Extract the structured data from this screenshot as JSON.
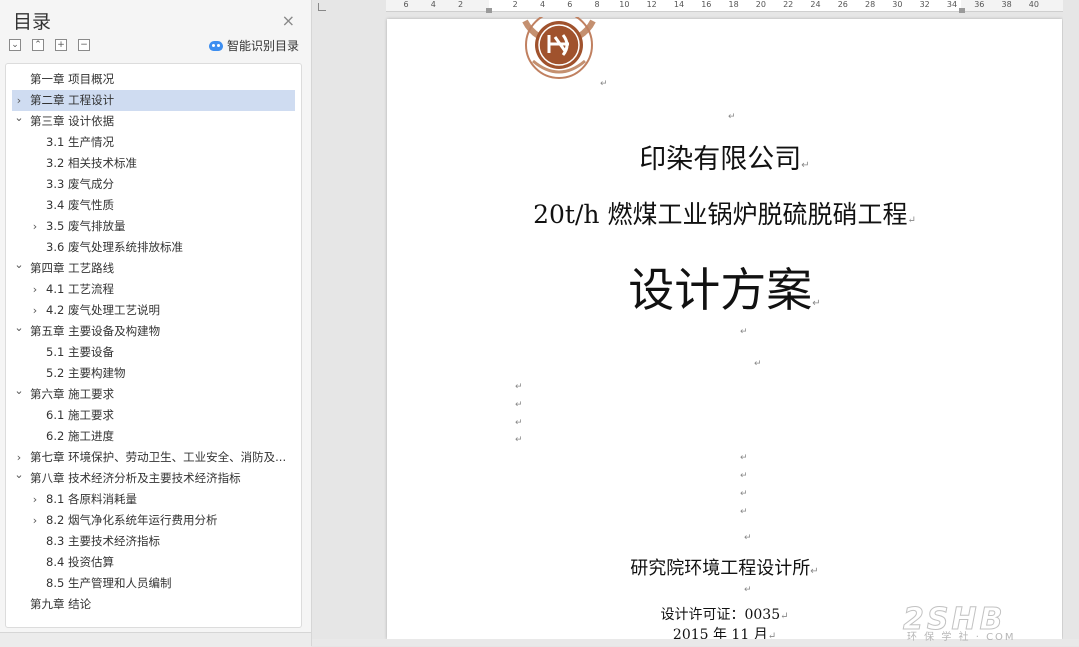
{
  "toc": {
    "title": "目录",
    "close_glyph": "×",
    "smart_label": "智能识别目录",
    "tool_icons": [
      "collapse-all-icon",
      "expand-all-icon",
      "add-heading-icon",
      "remove-heading-icon"
    ],
    "items": [
      {
        "label": "第一章 项目概况",
        "level": 1,
        "chevron": ""
      },
      {
        "label": "第二章 工程设计",
        "level": 1,
        "chevron": "right",
        "selected": true
      },
      {
        "label": "第三章 设计依据",
        "level": 1,
        "chevron": "down"
      },
      {
        "label": "3.1 生产情况",
        "level": 2,
        "chevron": ""
      },
      {
        "label": "3.2 相关技术标准",
        "level": 2,
        "chevron": ""
      },
      {
        "label": "3.3 废气成分",
        "level": 2,
        "chevron": ""
      },
      {
        "label": "3.4 废气性质",
        "level": 2,
        "chevron": ""
      },
      {
        "label": "3.5 废气排放量",
        "level": 2,
        "chevron": "right"
      },
      {
        "label": "3.6 废气处理系统排放标准",
        "level": 2,
        "chevron": ""
      },
      {
        "label": "第四章 工艺路线",
        "level": 1,
        "chevron": "down"
      },
      {
        "label": "4.1 工艺流程",
        "level": 2,
        "chevron": "right"
      },
      {
        "label": "4.2 废气处理工艺说明",
        "level": 2,
        "chevron": "right"
      },
      {
        "label": "第五章 主要设备及构建物",
        "level": 1,
        "chevron": "down"
      },
      {
        "label": "5.1 主要设备",
        "level": 2,
        "chevron": ""
      },
      {
        "label": "5.2 主要构建物",
        "level": 2,
        "chevron": ""
      },
      {
        "label": "第六章 施工要求",
        "level": 1,
        "chevron": "down"
      },
      {
        "label": "6.1 施工要求",
        "level": 2,
        "chevron": ""
      },
      {
        "label": "6.2 施工进度",
        "level": 2,
        "chevron": ""
      },
      {
        "label": "第七章 环境保护、劳动卫生、工业安全、消防及...",
        "level": 1,
        "chevron": "right"
      },
      {
        "label": "第八章 技术经济分析及主要技术经济指标",
        "level": 1,
        "chevron": "down"
      },
      {
        "label": "8.1 各原料消耗量",
        "level": 2,
        "chevron": "right"
      },
      {
        "label": "8.2 烟气净化系统年运行费用分析",
        "level": 2,
        "chevron": "right"
      },
      {
        "label": "8.3 主要技术经济指标",
        "level": 2,
        "chevron": ""
      },
      {
        "label": "8.4 投资估算",
        "level": 2,
        "chevron": ""
      },
      {
        "label": "8.5 生产管理和人员编制",
        "level": 2,
        "chevron": ""
      },
      {
        "label": "第九章 结论",
        "level": 1,
        "chevron": ""
      }
    ]
  },
  "ruler": {
    "ticks": [
      "6",
      "4",
      "2",
      "",
      "2",
      "4",
      "6",
      "8",
      "10",
      "12",
      "14",
      "16",
      "18",
      "20",
      "22",
      "24",
      "26",
      "28",
      "30",
      "32",
      "34",
      "36",
      "38",
      "40"
    ]
  },
  "document": {
    "seal_icon": "university-seal-icon",
    "paragraph_mark": "↵",
    "company": "印染有限公司",
    "project": "20t/h 燃煤工业锅炉脱硫脱硝工程",
    "scheme": "设计方案",
    "institute": "研究院环境工程设计所",
    "license": "设计许可证：0035",
    "date": "2015 年 11 月"
  },
  "watermark": {
    "big": "2SHB",
    "small": "环 保 学 社 · COM"
  },
  "colors": {
    "selected_row": "#cfdcf1",
    "smart_icon": "#3d8ef0",
    "seal": "#a0522d"
  }
}
